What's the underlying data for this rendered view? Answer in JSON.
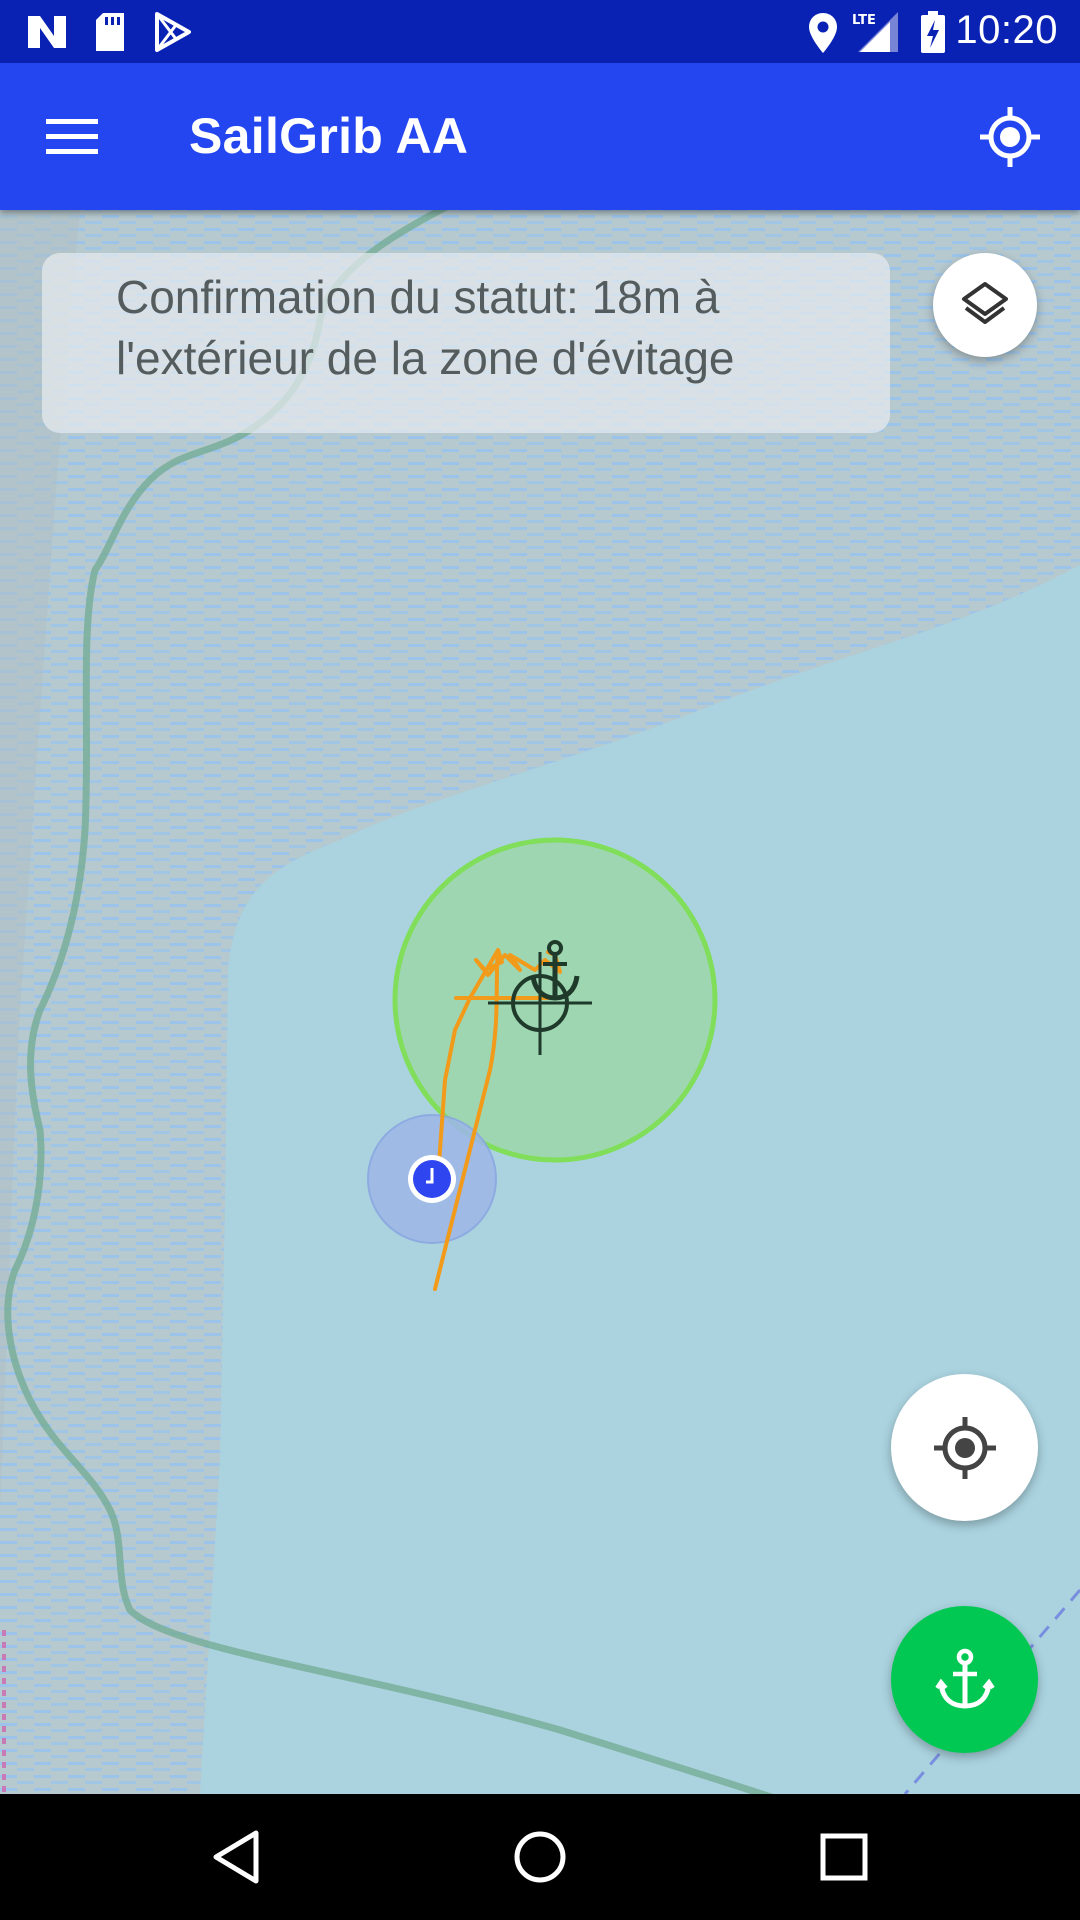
{
  "status_bar": {
    "time": "10:20",
    "network_label": "LTE",
    "icons": [
      "notification-n-icon",
      "sd-card-icon",
      "play-store-icon",
      "location-icon",
      "lte-signal-icon",
      "battery-charging-icon"
    ]
  },
  "app_bar": {
    "title": "SailGrib AA",
    "menu_icon": "hamburger-menu-icon",
    "gps_icon": "gps-fixed-icon"
  },
  "status_message": {
    "line1": "Confirmation du statut: 18m à",
    "line2": "l'extérieur de la zone d'évitage"
  },
  "map": {
    "water_color": "#aad3df",
    "shallow_color": "#b7c8cc",
    "swing_zone_color": "#9fd5b0",
    "swing_zone_border": "#7ed957",
    "track_color": "#f29a1a",
    "position_color": "#2e45f0",
    "anchor_icon": "anchor-icon",
    "target_icon": "crosshair-target-icon"
  },
  "buttons": {
    "layers_icon": "layers-icon",
    "locate_icon": "my-location-icon",
    "anchor_icon": "anchor-icon",
    "anchor_button_color": "#00c853"
  },
  "nav_bar": {
    "icons": [
      "back-icon",
      "home-icon",
      "recents-icon"
    ]
  }
}
